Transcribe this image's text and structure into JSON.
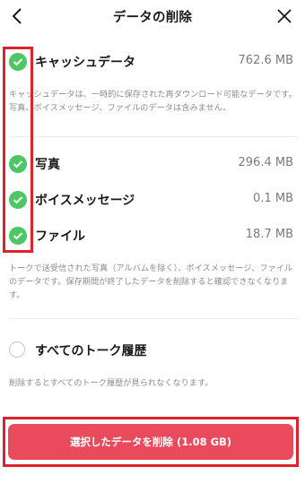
{
  "header": {
    "title": "データの削除"
  },
  "cache": {
    "label": "キャッシュデータ",
    "size": "762.6 MB",
    "checked": true,
    "description": "キャッシュデータは、一時的に保存された再ダウンロード可能なデータです。写真、ボイスメッセージ、ファイルのデータは含みません。"
  },
  "items": [
    {
      "label": "写真",
      "size": "296.4 MB",
      "checked": true
    },
    {
      "label": "ボイスメッセージ",
      "size": "0.1 MB",
      "checked": true
    },
    {
      "label": "ファイル",
      "size": "18.7 MB",
      "checked": true
    }
  ],
  "items_description": "トークで送受信された写真（アルバムを除く）、ボイスメッセージ、ファイルのデータです。保存期間が終了したデータを削除すると確認できなくなります。",
  "history": {
    "label": "すべてのトーク履歴",
    "checked": false,
    "description": "削除するとすべてのトーク履歴が見られなくなります。"
  },
  "delete_button": {
    "label": "選択したデータを削除 (1.08 GB)"
  },
  "colors": {
    "check_green": "#4cc764",
    "button_red": "#ea4b5c",
    "highlight_red": "#e0212b"
  }
}
